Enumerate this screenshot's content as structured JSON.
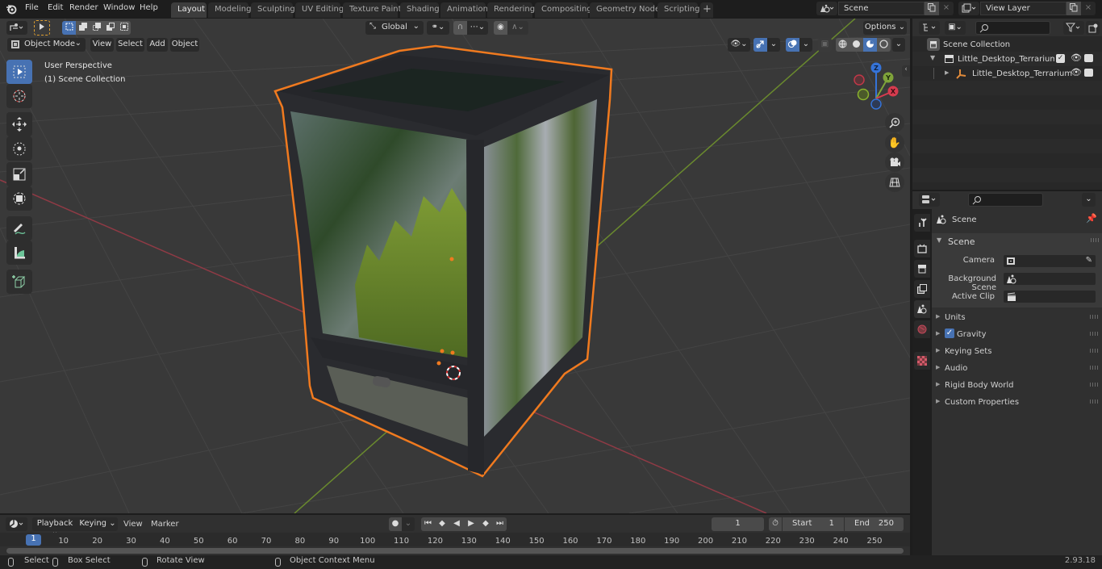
{
  "app": {
    "name": "Blender",
    "version": "2.93.18"
  },
  "menu": [
    "File",
    "Edit",
    "Render",
    "Window",
    "Help"
  ],
  "workspaces": [
    {
      "label": "Layout",
      "active": true
    },
    {
      "label": "Modeling"
    },
    {
      "label": "Sculpting"
    },
    {
      "label": "UV Editing"
    },
    {
      "label": "Texture Paint"
    },
    {
      "label": "Shading"
    },
    {
      "label": "Animation"
    },
    {
      "label": "Rendering"
    },
    {
      "label": "Compositing"
    },
    {
      "label": "Geometry Nodes"
    },
    {
      "label": "Scripting"
    }
  ],
  "add_workspace": "+",
  "scene_selector": {
    "value": "Scene"
  },
  "view_layer_selector": {
    "value": "View Layer"
  },
  "viewport": {
    "orientation": "Global",
    "options_label": "Options",
    "mode": "Object Mode",
    "header_menus": [
      "View",
      "Select",
      "Add",
      "Object"
    ],
    "overlay_text": {
      "view": "User Perspective",
      "collection": "(1) Scene Collection"
    },
    "gizmo_axes": {
      "x": "X",
      "y": "Y",
      "z": "Z"
    },
    "tools": [
      "select-box",
      "cursor",
      "move",
      "rotate",
      "scale",
      "transform",
      "annotate",
      "measure",
      "add-cube"
    ],
    "nav_buttons": [
      "zoom",
      "pan",
      "camera",
      "ortho-toggle"
    ],
    "shading_mode": "material-preview",
    "colors": {
      "selection_outline": "#f07a1f",
      "x_axis": "#c8454f",
      "y_axis": "#7fa33a",
      "active_tool": "#4772b3"
    }
  },
  "outliner": {
    "search_placeholder": "",
    "root": "Scene Collection",
    "items": [
      {
        "label": "Little_Desktop_Terrarium_witl",
        "type": "collection",
        "expanded": true,
        "checked": true
      },
      {
        "label": "Little_Desktop_Terrarium",
        "type": "empty",
        "expanded": false
      }
    ]
  },
  "properties": {
    "search_placeholder": "",
    "context_title": "Scene",
    "section": "Scene",
    "fields": [
      {
        "label": "Camera",
        "value": ""
      },
      {
        "label": "Background Scene",
        "value": ""
      },
      {
        "label": "Active Clip",
        "value": ""
      }
    ],
    "panels": [
      {
        "label": "Units"
      },
      {
        "label": "Gravity",
        "checkbox": true,
        "checked": true
      },
      {
        "label": "Keying Sets"
      },
      {
        "label": "Audio"
      },
      {
        "label": "Rigid Body World"
      },
      {
        "label": "Custom Properties"
      }
    ]
  },
  "timeline": {
    "menus": [
      "Playback",
      "Keying",
      "View",
      "Marker"
    ],
    "current_frame": "1",
    "start_label": "Start",
    "start": "1",
    "end_label": "End",
    "end": "250",
    "ruler": [
      "10",
      "20",
      "30",
      "40",
      "50",
      "60",
      "70",
      "80",
      "90",
      "100",
      "110",
      "120",
      "130",
      "140",
      "150",
      "160",
      "170",
      "180",
      "190",
      "200",
      "210",
      "220",
      "230",
      "240",
      "250"
    ],
    "playhead": "1"
  },
  "statusbar": {
    "select": "Select",
    "box_select": "Box Select",
    "rotate_view": "Rotate View",
    "context_menu": "Object Context Menu",
    "version": "2.93.18"
  }
}
